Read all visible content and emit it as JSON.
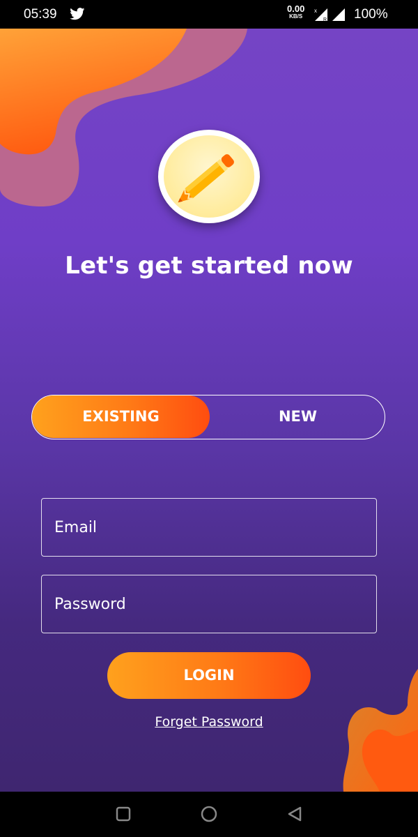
{
  "status_bar": {
    "time": "05:39",
    "speed_value": "0.00",
    "speed_unit": "KB/S",
    "battery": "100%",
    "icons": [
      "twitter-icon",
      "signal-icon",
      "signal-icon",
      "battery-text"
    ]
  },
  "login": {
    "headline": "Let's get started now",
    "toggle": {
      "existing_label": "EXISTING",
      "new_label": "NEW",
      "selected": "EXISTING"
    },
    "email_placeholder": "Email",
    "password_placeholder": "Password",
    "login_label": "LOGIN",
    "forgot_label": "Forget Password"
  },
  "colors": {
    "background_top": "#7544c5",
    "background_bottom": "#3f2670",
    "accent_start": "#ffa11d",
    "accent_end": "#ff4d10",
    "logo_fill": "#ffec9f"
  },
  "nav": {
    "icons": [
      "recent-apps-icon",
      "home-icon",
      "back-icon"
    ]
  }
}
